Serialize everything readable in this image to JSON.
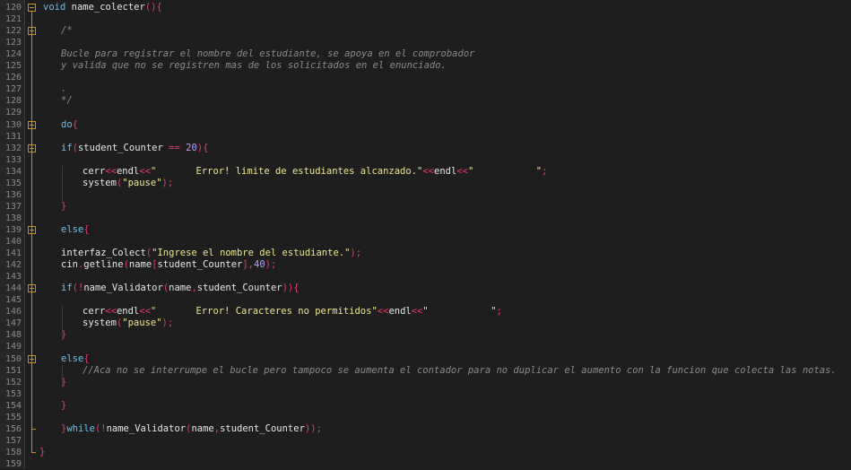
{
  "editor": {
    "line_numbers": [
      "120",
      "121",
      "122",
      "123",
      "124",
      "125",
      "126",
      "127",
      "128",
      "129",
      "130",
      "131",
      "132",
      "133",
      "134",
      "135",
      "136",
      "137",
      "138",
      "139",
      "140",
      "141",
      "142",
      "143",
      "144",
      "145",
      "146",
      "147",
      "148",
      "149",
      "150",
      "151",
      "152",
      "153",
      "154",
      "155",
      "156",
      "157",
      "158",
      "159"
    ],
    "colors": {
      "background": "#1e1e1e",
      "gutter": "#262626",
      "keyword": "#6ec0ec",
      "identifier": "#e6e6e6",
      "punctuation": "#e83a6c",
      "number": "#b99ef5",
      "string": "#ebe690",
      "comment": "#8b8b8b",
      "fold_marker": "#d08c1a"
    },
    "lines": [
      [
        [
          "kw",
          "void"
        ],
        [
          "id",
          " name_colecter"
        ],
        [
          "p",
          "(){"
        ]
      ],
      [],
      [
        [
          "com",
          "/*"
        ]
      ],
      [],
      [
        [
          "com",
          "Bucle para registrar el nombre del estudiante, se apoya en el comprobador"
        ]
      ],
      [
        [
          "com",
          "y valida que no se registren mas de los solicitados en el enunciado."
        ]
      ],
      [],
      [
        [
          "com",
          "."
        ]
      ],
      [
        [
          "com",
          "*/"
        ]
      ],
      [],
      [
        [
          "kw",
          "do"
        ],
        [
          "p",
          "{"
        ]
      ],
      [],
      [
        [
          "kw",
          "if"
        ],
        [
          "p",
          "("
        ],
        [
          "id",
          "student_Counter "
        ],
        [
          "p",
          "=="
        ],
        [
          "id",
          " "
        ],
        [
          "num",
          "20"
        ],
        [
          "p",
          "){"
        ]
      ],
      [],
      [
        [
          "id",
          "cerr"
        ],
        [
          "p",
          "<<"
        ],
        [
          "id",
          "endl"
        ],
        [
          "p",
          "<<"
        ],
        [
          "str",
          "\"       Error! limite de estudiantes alcanzado.\""
        ],
        [
          "p",
          "<<"
        ],
        [
          "id",
          "endl"
        ],
        [
          "p",
          "<<"
        ],
        [
          "str",
          "\"           \""
        ],
        [
          "p",
          ";"
        ]
      ],
      [
        [
          "id",
          "system"
        ],
        [
          "p",
          "("
        ],
        [
          "str",
          "\"pause\""
        ],
        [
          "p",
          ");"
        ]
      ],
      [],
      [
        [
          "p",
          "}"
        ]
      ],
      [],
      [
        [
          "kw",
          "else"
        ],
        [
          "p",
          "{"
        ]
      ],
      [],
      [
        [
          "id",
          "interfaz_Colect"
        ],
        [
          "p",
          "("
        ],
        [
          "str",
          "\"Ingrese el nombre del estudiante.\""
        ],
        [
          "p",
          ");"
        ]
      ],
      [
        [
          "id",
          "cin"
        ],
        [
          "p",
          "."
        ],
        [
          "id",
          "getline"
        ],
        [
          "p",
          "("
        ],
        [
          "id",
          "name"
        ],
        [
          "p",
          "["
        ],
        [
          "id",
          "student_Counter"
        ],
        [
          "p",
          "],"
        ],
        [
          "num",
          "40"
        ],
        [
          "p",
          ");"
        ]
      ],
      [],
      [
        [
          "kw",
          "if"
        ],
        [
          "p",
          "(!"
        ],
        [
          "id",
          "name_Validator"
        ],
        [
          "p",
          "("
        ],
        [
          "id",
          "name"
        ],
        [
          "p",
          ","
        ],
        [
          "id",
          "student_Counter"
        ],
        [
          "p",
          ")){"
        ]
      ],
      [],
      [
        [
          "id",
          "cerr"
        ],
        [
          "p",
          "<<"
        ],
        [
          "id",
          "endl"
        ],
        [
          "p",
          "<<"
        ],
        [
          "str",
          "\"       Error! Caracteres no permitidos\""
        ],
        [
          "p",
          "<<"
        ],
        [
          "id",
          "endl"
        ],
        [
          "p",
          "<<"
        ],
        [
          "str",
          "\"           \""
        ],
        [
          "p",
          ";"
        ]
      ],
      [
        [
          "id",
          "system"
        ],
        [
          "p",
          "("
        ],
        [
          "str",
          "\"pause\""
        ],
        [
          "p",
          ");"
        ]
      ],
      [
        [
          "p",
          "}"
        ]
      ],
      [],
      [
        [
          "kw",
          "else"
        ],
        [
          "p",
          "{"
        ]
      ],
      [
        [
          "com",
          "//Aca no se interrumpe el bucle pero tampoco se aumenta el contador para no duplicar el aumento con la funcion que colecta las notas."
        ]
      ],
      [
        [
          "p",
          "}"
        ]
      ],
      [],
      [
        [
          "p",
          "}"
        ]
      ],
      [],
      [
        [
          "p",
          "}"
        ],
        [
          "kw",
          "while"
        ],
        [
          "p",
          "(!"
        ],
        [
          "id",
          "name_Validator"
        ],
        [
          "p",
          "("
        ],
        [
          "id",
          "name"
        ],
        [
          "p",
          ","
        ],
        [
          "id",
          "student_Counter"
        ],
        [
          "p",
          "));"
        ]
      ],
      [],
      [
        [
          "p",
          "}"
        ]
      ],
      []
    ]
  }
}
